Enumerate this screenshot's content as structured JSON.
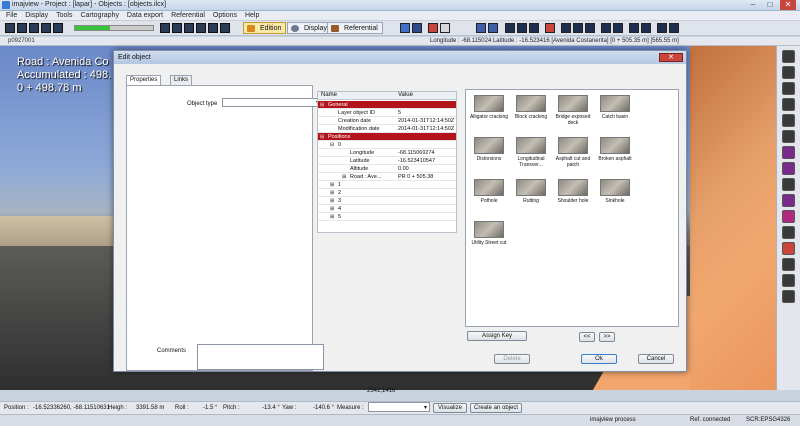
{
  "window": {
    "title": "imajview - Project : [lapar] - Objects : [objects.ilcx]",
    "controls": [
      "–",
      "□",
      "✕"
    ]
  },
  "menu": [
    "File",
    "Display",
    "Tools",
    "Cartography",
    "Data export",
    "Referential",
    "Options",
    "Help"
  ],
  "toolbar": {
    "progress": 0.45,
    "edition_label": "Edition",
    "display_label": "Display",
    "referential_label": "Referential"
  },
  "view": {
    "frame_id": "p0927001",
    "coords": "Longitude : -68.115024 Latitude : -16.523416 [Avenida Costanerita] [0 + 505.35 m] [565.55 m]",
    "road_line1": "Road : Avenida Co",
    "road_line2": "Accumulated : 498.",
    "road_line3": "0 + 498.78 m",
    "pixel_coords": "2341,1416"
  },
  "dialog": {
    "title": "Edit object",
    "close": "✕",
    "tabs": [
      "Properties",
      "Links"
    ],
    "object_type_label": "Object type",
    "object_type_value": "",
    "comments_label": "Comments",
    "grid": {
      "col_name": "Name",
      "col_value": "Value",
      "rows": [
        {
          "name": "General",
          "value": "",
          "section": true,
          "toggle": "⊟"
        },
        {
          "name": "Layer object ID",
          "value": "5"
        },
        {
          "name": "Creation date",
          "value": "2014-01-31T12:14:50Z"
        },
        {
          "name": "Modification date",
          "value": "2014-01-31T12:14:50Z"
        },
        {
          "name": "Positions",
          "value": "",
          "section": true,
          "toggle": "⊟"
        },
        {
          "name": "0",
          "value": "",
          "toggle": "⊟"
        },
        {
          "name": "Longitude",
          "value": "-68.115069274"
        },
        {
          "name": "Latitude",
          "value": "-16.523410547"
        },
        {
          "name": "Altitude",
          "value": "0.00"
        },
        {
          "name": "Road : Ave...",
          "value": "PR 0 + 505.38",
          "toggle": "⊞"
        },
        {
          "name": "1",
          "value": "",
          "toggle": "⊞"
        },
        {
          "name": "2",
          "value": "",
          "toggle": "⊞"
        },
        {
          "name": "3",
          "value": "",
          "toggle": "⊞"
        },
        {
          "name": "4",
          "value": "",
          "toggle": "⊞"
        },
        {
          "name": "5",
          "value": "",
          "toggle": "⊞"
        }
      ]
    },
    "gallery": [
      {
        "label": "Alligator cracking"
      },
      {
        "label": "Block cracking"
      },
      {
        "label": "Bridge exposed deck"
      },
      {
        "label": "Catch basin"
      },
      {
        "label": "Distorsions"
      },
      {
        "label": "Longitudinal Transver..."
      },
      {
        "label": "Asphalt cut and patch"
      },
      {
        "label": "Broken asphalt"
      },
      {
        "label": "Pothole"
      },
      {
        "label": "Rutting"
      },
      {
        "label": "Shoulder hole"
      },
      {
        "label": "Sinkhole"
      },
      {
        "label": "Utility Street cut"
      }
    ],
    "assign_key": "Assign Key",
    "prev": "<<",
    "next": ">>",
    "delete": "Delete",
    "ok": "Ok",
    "cancel": "Cancel"
  },
  "status": {
    "position": "Position :",
    "position_value": "-16.52336260, -68.11510631",
    "height_label": "Heigh :",
    "height_value": "3391.58 m",
    "roll_label": "Roll :",
    "roll_value": "-1.5 °",
    "pitch_label": "Pitch :",
    "pitch_value": "-13.4 °",
    "yaw_label": "Yaw :",
    "yaw_value": "-140.6 °",
    "measure_label": "Measure :",
    "visualize": "Visualize",
    "create_object": "Create an object",
    "process": "imajview process",
    "connection": "Ref. connected",
    "crs": "SCR:EPSG4326"
  }
}
